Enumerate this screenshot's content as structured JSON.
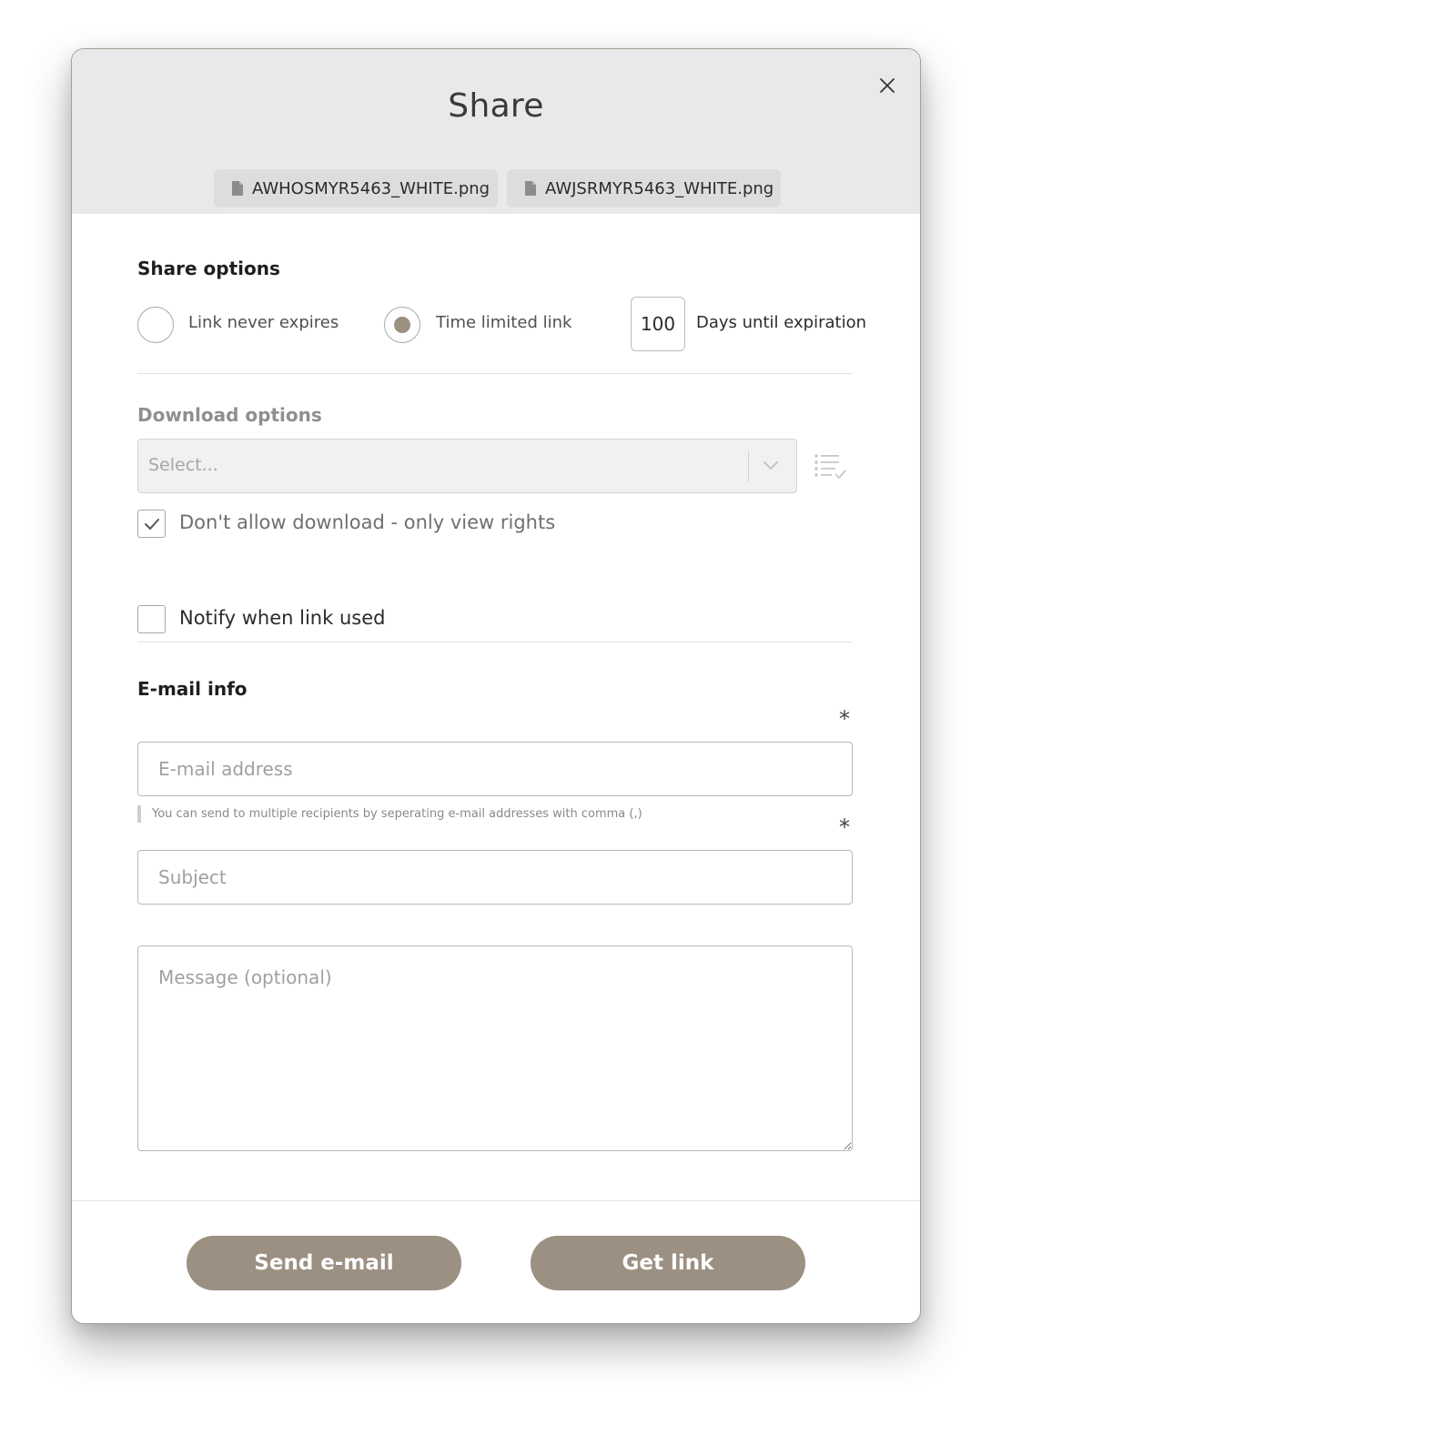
{
  "dialog": {
    "title": "Share"
  },
  "files": [
    {
      "name": "AWHOSMYR5463_WHITE.png",
      "icon": "file-icon"
    },
    {
      "name": "AWJSRMYR5463_WHITE.png",
      "icon": "file-icon"
    }
  ],
  "share_options": {
    "heading": "Share options",
    "never_expires_label": "Link never expires",
    "time_limited_label": "Time limited link",
    "selected": "time_limited",
    "days_value": "100",
    "days_label": "Days until expiration"
  },
  "download_options": {
    "heading": "Download options",
    "select_placeholder": "Select...",
    "no_download_label": "Don't allow download - only view rights",
    "no_download_checked": true
  },
  "notify": {
    "label": "Notify when link used",
    "checked": false
  },
  "email_info": {
    "heading": "E-mail info",
    "required_mark": "*",
    "email_placeholder": "E-mail address",
    "hint": "You can send to multiple recipients by seperating e-mail addresses with comma (,)",
    "subject_placeholder": "Subject",
    "message_placeholder": "Message (optional)"
  },
  "actions": {
    "send_label": "Send e-mail",
    "link_label": "Get link"
  },
  "colors": {
    "accent": "#9b9082",
    "header_bg": "#e9e9e9",
    "chip_bg": "#dddddd"
  }
}
